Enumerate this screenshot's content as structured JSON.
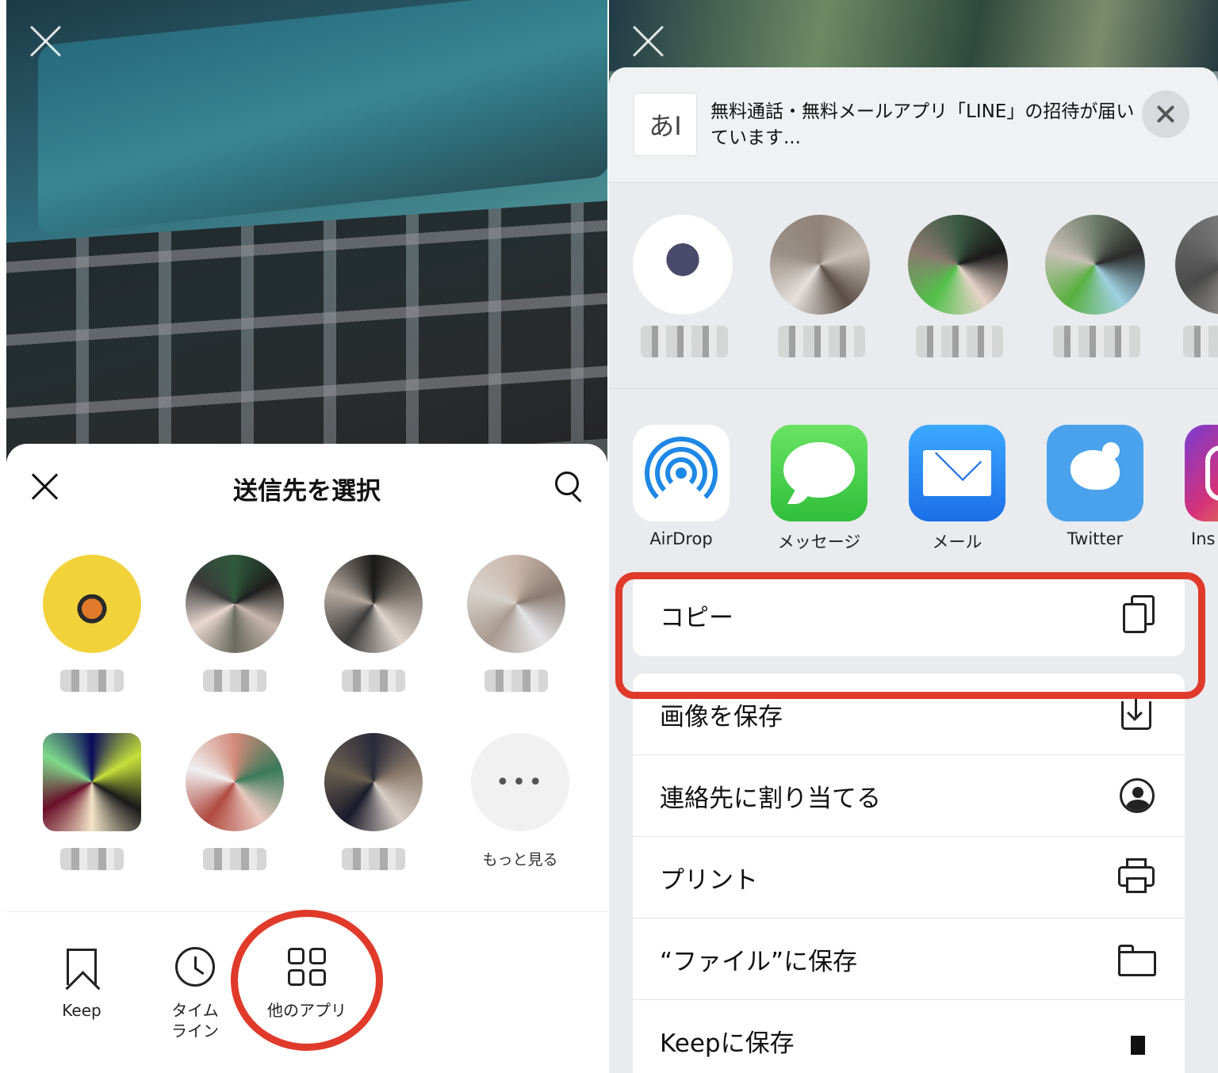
{
  "left_panel": {
    "sheet_title": "送信先を選択",
    "friends": [
      {
        "avatar_color": "#f2d23a"
      },
      {
        "avatar_color": "#6b6b5f"
      },
      {
        "avatar_color": "#55524f"
      },
      {
        "avatar_color": "#a99a90"
      },
      {
        "avatar_color": "#3a3a3a"
      },
      {
        "avatar_color": "#c96b5e"
      },
      {
        "avatar_color": "#5a5550"
      }
    ],
    "more_label": "もっと見る",
    "more_glyph": "•••",
    "shortcuts": [
      {
        "label": "Keep",
        "icon": "bookmark-icon"
      },
      {
        "label": "タイム\nライン",
        "icon": "clock-icon"
      },
      {
        "label": "他のアプリ",
        "icon": "apps-grid-icon"
      }
    ],
    "highlight_color": "#e03a2a"
  },
  "right_panel": {
    "share_preview_text": "無料通話・無料メールアプリ「LINE」の招待が届いています...",
    "doc_thumb_glyph": "あI",
    "contacts": [
      {
        "avatar_color": "#6a6a7a"
      },
      {
        "avatar_color": "#8f8378"
      },
      {
        "avatar_color": "#3c5a44"
      },
      {
        "avatar_color": "#6f7d6b"
      },
      {
        "avatar_color": "#7a7a7a"
      }
    ],
    "apps": [
      {
        "label": "AirDrop",
        "icon": "airdrop-icon"
      },
      {
        "label": "メッセージ",
        "icon": "messages-icon"
      },
      {
        "label": "メール",
        "icon": "mail-icon"
      },
      {
        "label": "Twitter",
        "icon": "twitter-icon"
      },
      {
        "label": "Ins",
        "icon": "instagram-icon"
      }
    ],
    "actions": [
      {
        "label": "コピー",
        "icon": "copy-icon"
      },
      {
        "label": "画像を保存",
        "icon": "save-image-icon"
      },
      {
        "label": "連絡先に割り当てる",
        "icon": "contact-icon"
      },
      {
        "label": "プリント",
        "icon": "print-icon"
      },
      {
        "label": "“ファイル”に保存",
        "icon": "folder-icon"
      },
      {
        "label": "Keepに保存",
        "icon": "keep-icon"
      }
    ],
    "highlight_color": "#e03a2a"
  }
}
